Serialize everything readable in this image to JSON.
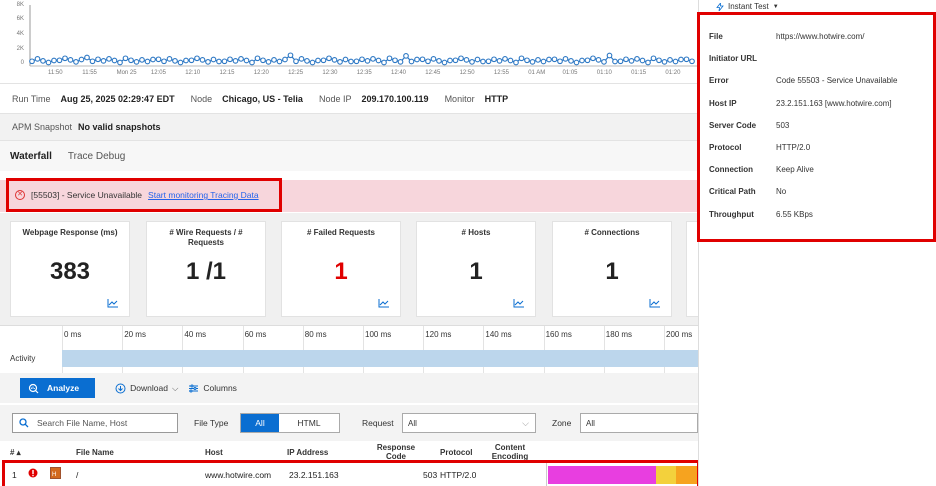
{
  "sparkline": {
    "y_ticks": [
      "8K",
      "6K",
      "4K",
      "2K",
      "0"
    ],
    "x_ticks": [
      "11:50",
      "11:55",
      "Mon 25",
      "12:05",
      "12:10",
      "12:15",
      "12:20",
      "12:25",
      "12:30",
      "12:35",
      "12:40",
      "12:45",
      "12:50",
      "12:55",
      "01 AM",
      "01:05",
      "01:10",
      "01:15",
      "01:20"
    ]
  },
  "run": {
    "run_time_label": "Run Time",
    "run_time_value": "Aug 25, 2025 02:29:47 EDT",
    "node_label": "Node",
    "node_value": "Chicago, US - Telia",
    "node_ip_label": "Node IP",
    "node_ip_value": "209.170.100.119",
    "monitor_label": "Monitor",
    "monitor_value": "HTTP"
  },
  "apm": {
    "label": "APM Snapshot",
    "value": "No valid snapshots"
  },
  "tabs": [
    {
      "label": "Waterfall"
    },
    {
      "label": "Trace Debug"
    }
  ],
  "error": {
    "code_text": "[55503] - Service Unavailable",
    "link": "Start monitoring Tracing Data"
  },
  "cards": [
    {
      "title": "Webpage Response (ms)",
      "value": "383"
    },
    {
      "title": "# Wire Requests / # Requests",
      "value": "1 /1"
    },
    {
      "title": "# Failed Requests",
      "value": "1"
    },
    {
      "title": "# Hosts",
      "value": "1"
    },
    {
      "title": "# Connections",
      "value": "1"
    }
  ],
  "timeline": {
    "ticks": [
      "0 ms",
      "20 ms",
      "40 ms",
      "60 ms",
      "80 ms",
      "100 ms",
      "120 ms",
      "140 ms",
      "160 ms",
      "180 ms",
      "200 ms"
    ],
    "row_label": "Activity"
  },
  "toolbar": {
    "analyze": "Analyze",
    "download": "Download",
    "columns": "Columns"
  },
  "filters": {
    "search_placeholder": "Search File Name, Host",
    "file_type_label": "File Type",
    "file_type_all": "All",
    "file_type_html": "HTML",
    "request_label": "Request",
    "request_value": "All",
    "zone_label": "Zone",
    "zone_value": "All"
  },
  "table": {
    "headers": {
      "num": "# ▴",
      "file_name": "File Name",
      "host": "Host",
      "ip": "IP Address",
      "response_code": "Response Code",
      "protocol": "Protocol",
      "content_encoding": "Content Encoding"
    },
    "rows": [
      {
        "num": "1",
        "file_name": "/",
        "host": "www.hotwire.com",
        "ip": "23.2.151.163",
        "response_code": "503",
        "protocol": "HTTP/2.0"
      }
    ]
  },
  "panel": {
    "header": "Instant Test",
    "fields": [
      {
        "key": "File",
        "value": "https://www.hotwire.com/"
      },
      {
        "key": "Initiator URL",
        "value": ""
      },
      {
        "key": "Error",
        "value": "Code 55503 - Service Unavailable"
      },
      {
        "key": "Host IP",
        "value": "23.2.151.163 [www.hotwire.com]"
      },
      {
        "key": "Server Code",
        "value": "503"
      },
      {
        "key": "Protocol",
        "value": "HTTP/2.0"
      },
      {
        "key": "Connection",
        "value": "Keep Alive"
      },
      {
        "key": "Critical Path",
        "value": "No"
      },
      {
        "key": "Throughput",
        "value": "6.55 KBps"
      }
    ]
  },
  "colors": {
    "primary": "#0a6ed1",
    "error_red": "#e00000",
    "error_band": "#f7d6dc",
    "activity_bar": "#bcd6ec",
    "bar_magenta": "#e83ee0",
    "bar_yellow": "#f3d13c",
    "bar_orange": "#f6a31f"
  }
}
